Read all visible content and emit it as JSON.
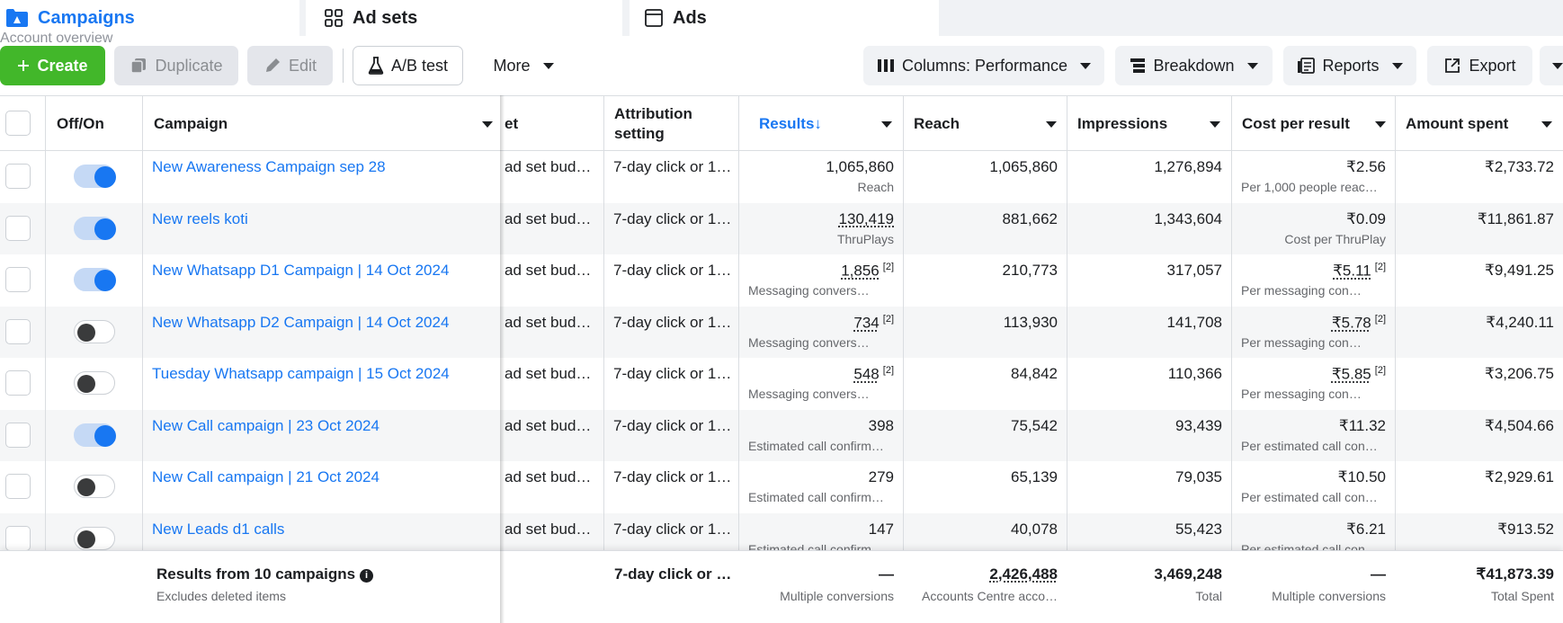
{
  "tabs": {
    "campaigns": "Campaigns",
    "adsets": "Ad sets",
    "ads": "Ads",
    "account_overview": "Account overview"
  },
  "toolbar": {
    "create": "Create",
    "duplicate": "Duplicate",
    "edit": "Edit",
    "ab_test": "A/B test",
    "more": "More",
    "columns": "Columns: Performance",
    "breakdown": "Breakdown",
    "reports": "Reports",
    "export": "Export"
  },
  "columns": {
    "offon": "Off/On",
    "campaign": "Campaign",
    "budget_partial": "et",
    "attribution": "Attribution setting",
    "results": "Results",
    "results_sort_glyph": "↓",
    "reach": "Reach",
    "impressions": "Impressions",
    "cost_per_result": "Cost per result",
    "amount_spent": "Amount spent"
  },
  "colors": {
    "accent": "#1877f2",
    "create_green": "#42b72a",
    "toggle_on_track": "#c5d9f5"
  },
  "rows": [
    {
      "on": true,
      "name": "New Awareness Campaign sep 28",
      "budget": "ad set bud…",
      "attribution": "7-day click or 1…",
      "results": "1,065,860",
      "results_sup": "",
      "results_sub": "Reach",
      "reach": "1,065,860",
      "impressions": "1,276,894",
      "cpr": "₹2.56",
      "cpr_sup": "",
      "cpr_sub": "Per 1,000 people reac…",
      "spent": "₹2,733.72"
    },
    {
      "on": true,
      "name": "New reels koti",
      "budget": "ad set bud…",
      "attribution": "7-day click or 1…",
      "results": "130,419",
      "results_sup": "",
      "results_sub": "ThruPlays",
      "reach": "881,662",
      "impressions": "1,343,604",
      "cpr": "₹0.09",
      "cpr_sup": "",
      "cpr_sub": "Cost per ThruPlay",
      "spent": "₹11,861.87"
    },
    {
      "on": true,
      "name": "New Whatsapp D1 Campaign | 14 Oct 2024",
      "budget": "ad set bud…",
      "attribution": "7-day click or 1…",
      "results": "1,856",
      "results_sup": "[2]",
      "results_sub": "Messaging convers…",
      "reach": "210,773",
      "impressions": "317,057",
      "cpr": "₹5.11",
      "cpr_sup": "[2]",
      "cpr_sub": "Per messaging con…",
      "spent": "₹9,491.25"
    },
    {
      "on": false,
      "name": "New Whatsapp D2 Campaign | 14 Oct 2024",
      "budget": "ad set bud…",
      "attribution": "7-day click or 1…",
      "results": "734",
      "results_sup": "[2]",
      "results_sub": "Messaging convers…",
      "reach": "113,930",
      "impressions": "141,708",
      "cpr": "₹5.78",
      "cpr_sup": "[2]",
      "cpr_sub": "Per messaging con…",
      "spent": "₹4,240.11"
    },
    {
      "on": false,
      "name": "Tuesday Whatsapp campaign | 15 Oct 2024",
      "budget": "ad set bud…",
      "attribution": "7-day click or 1…",
      "results": "548",
      "results_sup": "[2]",
      "results_sub": "Messaging convers…",
      "reach": "84,842",
      "impressions": "110,366",
      "cpr": "₹5.85",
      "cpr_sup": "[2]",
      "cpr_sub": "Per messaging con…",
      "spent": "₹3,206.75"
    },
    {
      "on": true,
      "name": "New Call campaign | 23 Oct 2024",
      "budget": "ad set bud…",
      "attribution": "7-day click or 1…",
      "results": "398",
      "results_sup": "",
      "results_sub": "Estimated call confirm…",
      "reach": "75,542",
      "impressions": "93,439",
      "cpr": "₹11.32",
      "cpr_sup": "",
      "cpr_sub": "Per estimated call con…",
      "spent": "₹4,504.66"
    },
    {
      "on": false,
      "name": "New Call campaign | 21 Oct 2024",
      "budget": "ad set bud…",
      "attribution": "7-day click or 1…",
      "results": "279",
      "results_sup": "",
      "results_sub": "Estimated call confirm…",
      "reach": "65,139",
      "impressions": "79,035",
      "cpr": "₹10.50",
      "cpr_sup": "",
      "cpr_sub": "Per estimated call con…",
      "spent": "₹2,929.61"
    },
    {
      "on": false,
      "name": "New Leads d1 calls",
      "budget": "ad set bud…",
      "attribution": "7-day click or 1…",
      "results": "147",
      "results_sup": "",
      "results_sub": "Estimated call confirm…",
      "reach": "40,078",
      "impressions": "55,423",
      "cpr": "₹6.21",
      "cpr_sup": "",
      "cpr_sub": "Per estimated call con…",
      "spent": "₹913.52"
    }
  ],
  "summary": {
    "title": "Results from 10 campaigns",
    "subtitle": "Excludes deleted items",
    "attribution": "7-day click or …",
    "results": "—",
    "results_sub": "Multiple conversions",
    "reach": "2,426,488",
    "reach_sub": "Accounts Centre acco…",
    "impressions": "3,469,248",
    "impressions_sub": "Total",
    "cpr": "—",
    "cpr_sub": "Multiple conversions",
    "spent": "₹41,873.39",
    "spent_sub": "Total Spent"
  }
}
